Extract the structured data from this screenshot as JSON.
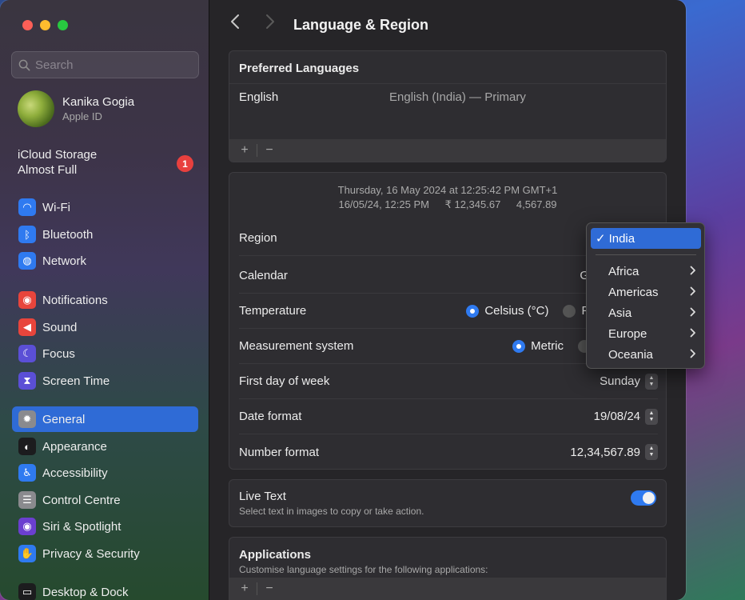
{
  "sidebar": {
    "search_placeholder": "Search",
    "profile": {
      "name": "Kanika Gogia",
      "subtitle": "Apple ID"
    },
    "icloud": {
      "line1": "iCloud Storage",
      "line2": "Almost Full",
      "badge": "1"
    },
    "items": [
      {
        "label": "Wi-Fi",
        "icon": "wifi-icon",
        "color": "#2f7af0"
      },
      {
        "label": "Bluetooth",
        "icon": "bluetooth-icon",
        "color": "#2f7af0"
      },
      {
        "label": "Network",
        "icon": "globe-icon",
        "color": "#2f7af0"
      },
      {
        "label": "Notifications",
        "icon": "bell-icon",
        "color": "#e8453c"
      },
      {
        "label": "Sound",
        "icon": "speaker-icon",
        "color": "#e8453c"
      },
      {
        "label": "Focus",
        "icon": "moon-icon",
        "color": "#5b4fd6"
      },
      {
        "label": "Screen Time",
        "icon": "hourglass-icon",
        "color": "#5b4fd6"
      },
      {
        "label": "General",
        "icon": "gear-icon",
        "color": "#8a8a8e"
      },
      {
        "label": "Appearance",
        "icon": "appearance-icon",
        "color": "#1c1c1e"
      },
      {
        "label": "Accessibility",
        "icon": "accessibility-icon",
        "color": "#2f7af0"
      },
      {
        "label": "Control Centre",
        "icon": "control-centre-icon",
        "color": "#8a8a8e"
      },
      {
        "label": "Siri & Spotlight",
        "icon": "siri-icon",
        "color": "#6b3fd0"
      },
      {
        "label": "Privacy & Security",
        "icon": "hand-icon",
        "color": "#2f7af0"
      },
      {
        "label": "Desktop & Dock",
        "icon": "dock-icon",
        "color": "#1c1c1e"
      }
    ],
    "active": "General"
  },
  "header": {
    "title": "Language & Region"
  },
  "preferred_languages": {
    "title": "Preferred Languages",
    "language": "English",
    "detail": "English (India) — Primary",
    "add": "+",
    "remove": "−"
  },
  "format": {
    "preview_line1": "Thursday, 16 May 2024 at 12:25:42 PM GMT+1",
    "preview_date": "16/05/24, 12:25 PM",
    "preview_currency": "₹ 12,345.67",
    "preview_number": "4,567.89",
    "region_label": "Region",
    "calendar_label": "Calendar",
    "calendar_value_partial": "G",
    "temperature_label": "Temperature",
    "temperature_celsius": "Celsius (°C)",
    "temperature_fahrenheit_partial": "Fa",
    "measurement_label": "Measurement system",
    "measurement_metric": "Metric",
    "first_day_label": "First day of week",
    "first_day_value": "Sunday",
    "date_format_label": "Date format",
    "date_format_value": "19/08/24",
    "number_format_label": "Number format",
    "number_format_value": "12,34,567.89"
  },
  "live_text": {
    "title": "Live Text",
    "description": "Select text in images to copy or take action.",
    "enabled": true
  },
  "applications": {
    "title": "Applications",
    "description": "Customise language settings for the following applications:",
    "add": "+",
    "remove": "−"
  },
  "region_menu": {
    "selected": "India",
    "check": "✓",
    "items": [
      "Africa",
      "Americas",
      "Asia",
      "Europe",
      "Oceania"
    ]
  }
}
